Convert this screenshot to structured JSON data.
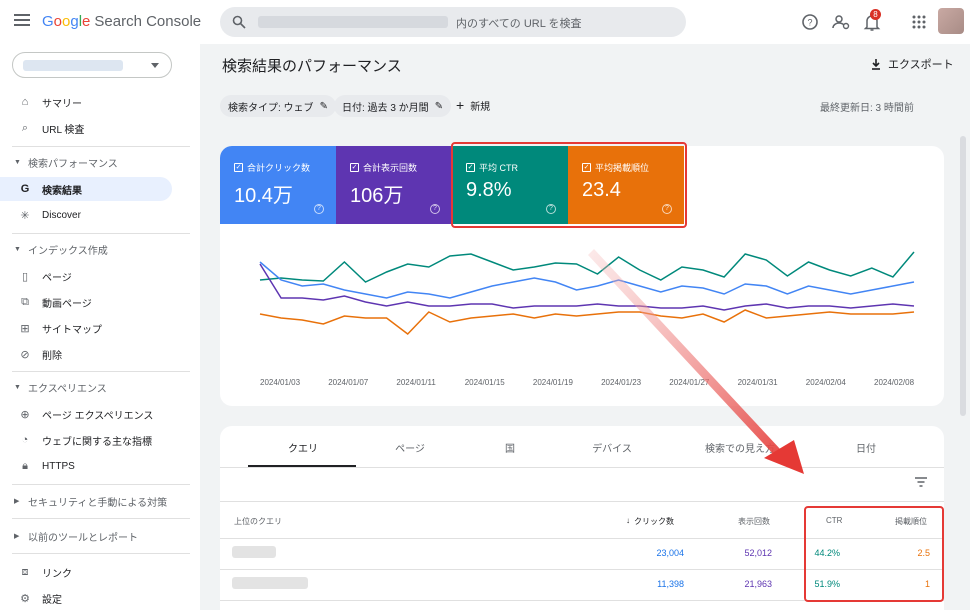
{
  "app": {
    "logo_parts": [
      "G",
      "o",
      "o",
      "g",
      "l",
      "e"
    ],
    "product": "Search Console"
  },
  "search": {
    "placeholder": "内のすべての URL を検査"
  },
  "notifications": {
    "count": "8"
  },
  "sidebar": {
    "items": {
      "summary": "サマリー",
      "url_inspection": "URL 検査",
      "search_results": "検索結果",
      "discover": "Discover",
      "pages": "ページ",
      "video_pages": "動画ページ",
      "sitemaps": "サイトマップ",
      "removals": "削除",
      "page_experience": "ページ エクスペリエンス",
      "core_web_vitals": "ウェブに関する主な指標",
      "https": "HTTPS",
      "links": "リンク",
      "settings": "設定"
    },
    "sections": {
      "performance": "検索パフォーマンス",
      "indexing": "インデックス作成",
      "experience": "エクスペリエンス",
      "security": "セキュリティと手動による対策",
      "legacy": "以前のツールとレポート"
    }
  },
  "main": {
    "title": "検索結果のパフォーマンス",
    "export_label": "エクスポート",
    "filters": [
      "検索タイプ: ウェブ",
      "日付: 過去 3 か月間"
    ],
    "new_label": "新規",
    "last_updated": "最終更新日: 3 時間前"
  },
  "metrics": [
    {
      "label": "合計クリック数",
      "value": "10.4万",
      "color": "#4285f4"
    },
    {
      "label": "合計表示回数",
      "value": "106万",
      "color": "#5e35b1"
    },
    {
      "label": "平均 CTR",
      "value": "9.8%",
      "color": "#00897b"
    },
    {
      "label": "平均掲載順位",
      "value": "23.4",
      "color": "#e8710a"
    }
  ],
  "chart_data": {
    "type": "line",
    "x": [
      "2024/01/03",
      "2024/01/07",
      "2024/01/11",
      "2024/01/15",
      "2024/01/19",
      "2024/01/23",
      "2024/01/27",
      "2024/01/31",
      "2024/02/04",
      "2024/02/08"
    ],
    "x_ticks": [
      "2024/01/03",
      "2024/01/07",
      "2024/01/11",
      "2024/01/15",
      "2024/01/19",
      "2024/01/23",
      "2024/01/27",
      "2024/01/31",
      "2024/02/04",
      "2024/02/08"
    ],
    "y_unit": "relative",
    "ylim": [
      0,
      100
    ],
    "series": [
      {
        "color": "#00897b",
        "values": [
          62,
          64,
          62,
          61,
          80,
          60,
          70,
          78,
          75,
          86,
          88,
          80,
          72,
          75,
          79,
          78,
          68,
          85,
          72,
          62,
          75,
          72,
          65,
          88,
          82,
          66,
          80,
          72,
          66,
          74,
          65,
          90
        ]
      },
      {
        "color": "#4285f4",
        "values": [
          80,
          62,
          56,
          58,
          52,
          48,
          44,
          50,
          48,
          44,
          50,
          56,
          60,
          64,
          60,
          52,
          56,
          62,
          56,
          50,
          56,
          54,
          48,
          58,
          56,
          48,
          56,
          52,
          48,
          52,
          56,
          60
        ]
      },
      {
        "color": "#5e35b1",
        "values": [
          78,
          44,
          44,
          42,
          46,
          40,
          36,
          40,
          36,
          36,
          38,
          38,
          34,
          36,
          36,
          36,
          38,
          36,
          36,
          34,
          34,
          36,
          32,
          36,
          38,
          34,
          36,
          36,
          34,
          36,
          38,
          36
        ]
      },
      {
        "color": "#e8710a",
        "values": [
          28,
          24,
          22,
          18,
          26,
          24,
          24,
          8,
          30,
          20,
          24,
          26,
          28,
          24,
          28,
          26,
          28,
          30,
          30,
          26,
          24,
          28,
          20,
          32,
          24,
          26,
          28,
          30,
          28,
          28,
          28,
          30
        ]
      }
    ]
  },
  "tabs": [
    "クエリ",
    "ページ",
    "国",
    "デバイス",
    "検索での見え方",
    "日付"
  ],
  "table": {
    "headers": {
      "query": "上位のクエリ",
      "clicks": "クリック数",
      "impressions": "表示回数",
      "ctr": "CTR",
      "position": "掲載順位"
    },
    "rows": [
      {
        "clicks": "23,004",
        "impressions": "52,012",
        "ctr": "44.2%",
        "position": "2.5"
      },
      {
        "clicks": "11,398",
        "impressions": "21,963",
        "ctr": "51.9%",
        "position": "1"
      }
    ]
  },
  "colors": {
    "accent": "#1a73e8",
    "annotation": "#e53935"
  }
}
